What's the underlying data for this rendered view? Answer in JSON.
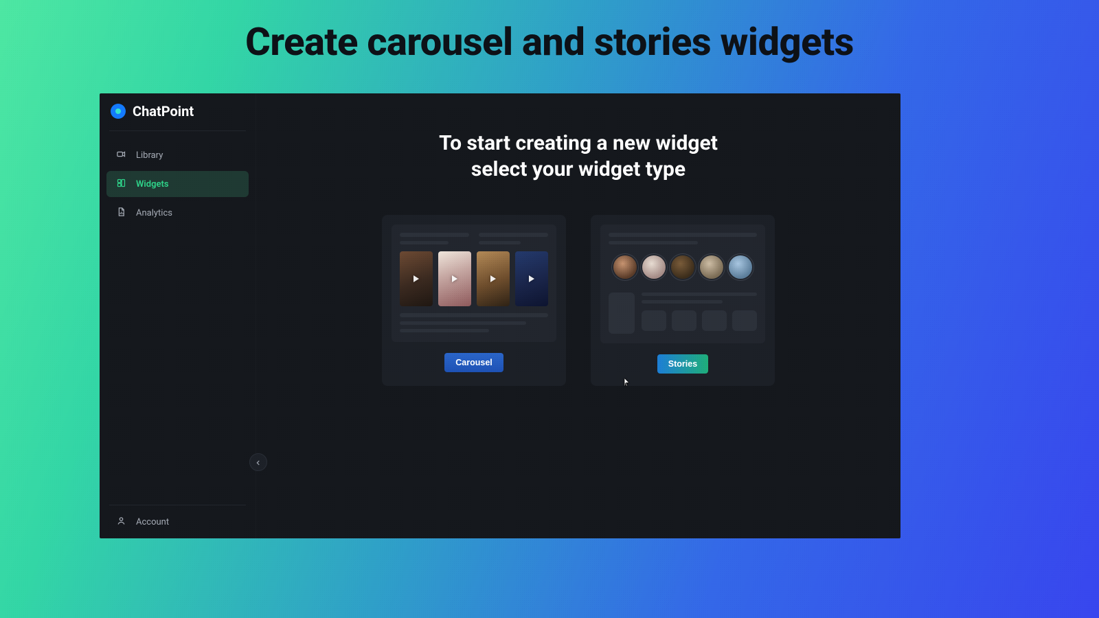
{
  "page": {
    "heading": "Create carousel and stories widgets"
  },
  "brand": {
    "name": "ChatPoint"
  },
  "sidebar": {
    "items": [
      {
        "label": "Library",
        "icon": "video-camera-icon",
        "active": false
      },
      {
        "label": "Widgets",
        "icon": "widget-icon",
        "active": true
      },
      {
        "label": "Analytics",
        "icon": "document-chart-icon",
        "active": false
      }
    ],
    "account_label": "Account"
  },
  "main": {
    "heading_line1": "To start creating a new widget",
    "heading_line2": "select your widget type",
    "cards": {
      "carousel": {
        "label": "Carousel"
      },
      "stories": {
        "label": "Stories"
      }
    }
  }
}
